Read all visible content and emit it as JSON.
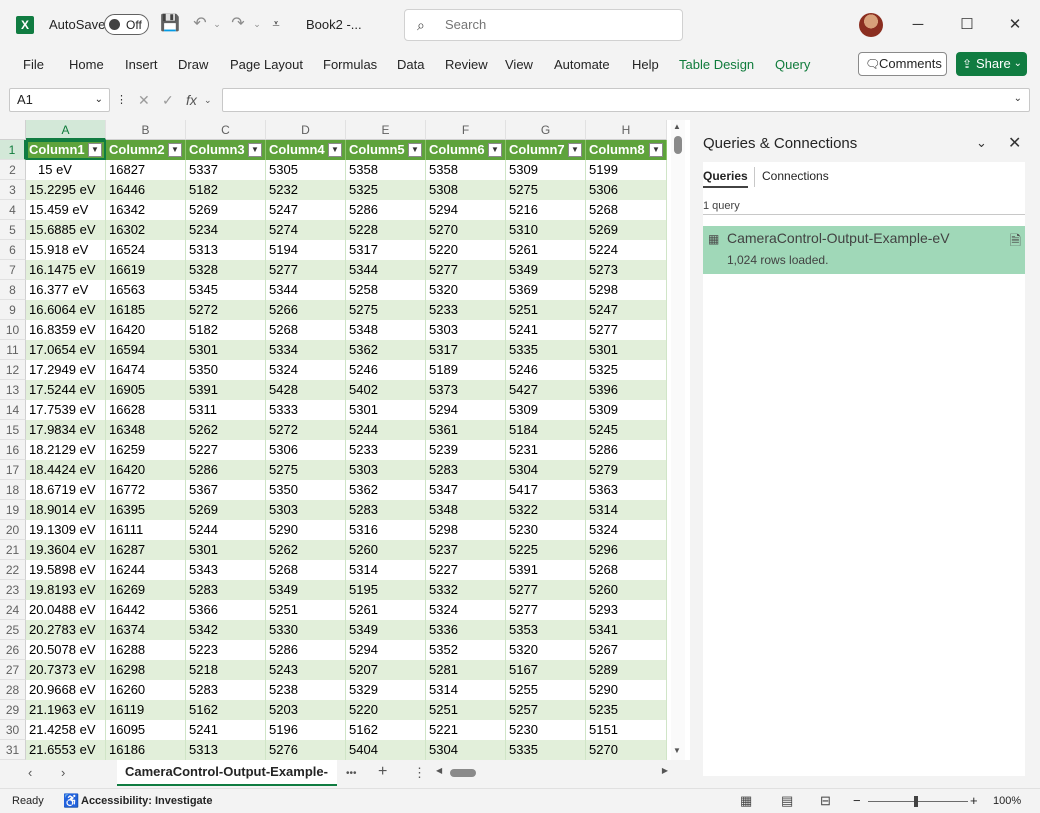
{
  "titlebar": {
    "app_icon": "X",
    "autosave_label": "AutoSave",
    "autosave_state": "Off",
    "doc_title": "Book2  -...",
    "search_placeholder": "Search",
    "minimize": "─",
    "maximize": "☐",
    "close": "✕"
  },
  "ribbon": {
    "tabs": [
      {
        "label": "File"
      },
      {
        "label": "Home"
      },
      {
        "label": "Insert"
      },
      {
        "label": "Draw"
      },
      {
        "label": "Page Layout"
      },
      {
        "label": "Formulas"
      },
      {
        "label": "Data"
      },
      {
        "label": "Review"
      },
      {
        "label": "View"
      },
      {
        "label": "Automate"
      },
      {
        "label": "Help"
      },
      {
        "label": "Table Design"
      },
      {
        "label": "Query"
      }
    ],
    "comments_label": "Comments",
    "share_label": "Share"
  },
  "formula_bar": {
    "name_box": "A1",
    "fx": "fx",
    "value": ""
  },
  "grid": {
    "columns": [
      "A",
      "B",
      "C",
      "D",
      "E",
      "F",
      "G",
      "H"
    ],
    "header_row_number": "1",
    "table_headers": [
      "Column1",
      "Column2",
      "Column3",
      "Column4",
      "Column5",
      "Column6",
      "Column7",
      "Column8"
    ],
    "rows": [
      {
        "n": "2",
        "c": [
          "15 eV",
          "16827",
          "5337",
          "5305",
          "5358",
          "5358",
          "5309",
          "5199"
        ]
      },
      {
        "n": "3",
        "c": [
          "15.2295 eV",
          "16446",
          "5182",
          "5232",
          "5325",
          "5308",
          "5275",
          "5306"
        ]
      },
      {
        "n": "4",
        "c": [
          "15.459 eV",
          "16342",
          "5269",
          "5247",
          "5286",
          "5294",
          "5216",
          "5268"
        ]
      },
      {
        "n": "5",
        "c": [
          "15.6885 eV",
          "16302",
          "5234",
          "5274",
          "5228",
          "5270",
          "5310",
          "5269"
        ]
      },
      {
        "n": "6",
        "c": [
          "15.918 eV",
          "16524",
          "5313",
          "5194",
          "5317",
          "5220",
          "5261",
          "5224"
        ]
      },
      {
        "n": "7",
        "c": [
          "16.1475 eV",
          "16619",
          "5328",
          "5277",
          "5344",
          "5277",
          "5349",
          "5273"
        ]
      },
      {
        "n": "8",
        "c": [
          "16.377 eV",
          "16563",
          "5345",
          "5344",
          "5258",
          "5320",
          "5369",
          "5298"
        ]
      },
      {
        "n": "9",
        "c": [
          "16.6064 eV",
          "16185",
          "5272",
          "5266",
          "5275",
          "5233",
          "5251",
          "5247"
        ]
      },
      {
        "n": "10",
        "c": [
          "16.8359 eV",
          "16420",
          "5182",
          "5268",
          "5348",
          "5303",
          "5241",
          "5277"
        ]
      },
      {
        "n": "11",
        "c": [
          "17.0654 eV",
          "16594",
          "5301",
          "5334",
          "5362",
          "5317",
          "5335",
          "5301"
        ]
      },
      {
        "n": "12",
        "c": [
          "17.2949 eV",
          "16474",
          "5350",
          "5324",
          "5246",
          "5189",
          "5246",
          "5325"
        ]
      },
      {
        "n": "13",
        "c": [
          "17.5244 eV",
          "16905",
          "5391",
          "5428",
          "5402",
          "5373",
          "5427",
          "5396"
        ]
      },
      {
        "n": "14",
        "c": [
          "17.7539 eV",
          "16628",
          "5311",
          "5333",
          "5301",
          "5294",
          "5309",
          "5309"
        ]
      },
      {
        "n": "15",
        "c": [
          "17.9834 eV",
          "16348",
          "5262",
          "5272",
          "5244",
          "5361",
          "5184",
          "5245"
        ]
      },
      {
        "n": "16",
        "c": [
          "18.2129 eV",
          "16259",
          "5227",
          "5306",
          "5233",
          "5239",
          "5231",
          "5286"
        ]
      },
      {
        "n": "17",
        "c": [
          "18.4424 eV",
          "16420",
          "5286",
          "5275",
          "5303",
          "5283",
          "5304",
          "5279"
        ]
      },
      {
        "n": "18",
        "c": [
          "18.6719 eV",
          "16772",
          "5367",
          "5350",
          "5362",
          "5347",
          "5417",
          "5363"
        ]
      },
      {
        "n": "19",
        "c": [
          "18.9014 eV",
          "16395",
          "5269",
          "5303",
          "5283",
          "5348",
          "5322",
          "5314"
        ]
      },
      {
        "n": "20",
        "c": [
          "19.1309 eV",
          "16111",
          "5244",
          "5290",
          "5316",
          "5298",
          "5230",
          "5324"
        ]
      },
      {
        "n": "21",
        "c": [
          "19.3604 eV",
          "16287",
          "5301",
          "5262",
          "5260",
          "5237",
          "5225",
          "5296"
        ]
      },
      {
        "n": "22",
        "c": [
          "19.5898 eV",
          "16244",
          "5343",
          "5268",
          "5314",
          "5227",
          "5391",
          "5268"
        ]
      },
      {
        "n": "23",
        "c": [
          "19.8193 eV",
          "16269",
          "5283",
          "5349",
          "5195",
          "5332",
          "5277",
          "5260"
        ]
      },
      {
        "n": "24",
        "c": [
          "20.0488 eV",
          "16442",
          "5366",
          "5251",
          "5261",
          "5324",
          "5277",
          "5293"
        ]
      },
      {
        "n": "25",
        "c": [
          "20.2783 eV",
          "16374",
          "5342",
          "5330",
          "5349",
          "5336",
          "5353",
          "5341"
        ]
      },
      {
        "n": "26",
        "c": [
          "20.5078 eV",
          "16288",
          "5223",
          "5286",
          "5294",
          "5352",
          "5320",
          "5267"
        ]
      },
      {
        "n": "27",
        "c": [
          "20.7373 eV",
          "16298",
          "5218",
          "5243",
          "5207",
          "5281",
          "5167",
          "5289"
        ]
      },
      {
        "n": "28",
        "c": [
          "20.9668 eV",
          "16260",
          "5283",
          "5238",
          "5329",
          "5314",
          "5255",
          "5290"
        ]
      },
      {
        "n": "29",
        "c": [
          "21.1963 eV",
          "16119",
          "5162",
          "5203",
          "5220",
          "5251",
          "5257",
          "5235"
        ]
      },
      {
        "n": "30",
        "c": [
          "21.4258 eV",
          "16095",
          "5241",
          "5196",
          "5162",
          "5221",
          "5230",
          "5151"
        ]
      },
      {
        "n": "31",
        "c": [
          "21.6553 eV",
          "16186",
          "5313",
          "5276",
          "5404",
          "5304",
          "5335",
          "5270"
        ]
      }
    ]
  },
  "sheetbar": {
    "sheet_name": "CameraControl-Output-Example-",
    "more": "•••",
    "add": "+"
  },
  "panel": {
    "title": "Queries & Connections",
    "tab_queries": "Queries",
    "tab_connections": "Connections",
    "count": "1 query",
    "query_name": "CameraControl-Output-Example-eV",
    "query_status": "1,024 rows loaded."
  },
  "status": {
    "ready": "Ready",
    "accessibility": "Accessibility: Investigate",
    "zoom_minus": "−",
    "zoom_plus": "+",
    "zoom": "100%"
  },
  "colors": {
    "accent": "#107c41",
    "table_header": "#70ad47",
    "band": "#e2efda",
    "query_selected": "#a0d8b8"
  }
}
